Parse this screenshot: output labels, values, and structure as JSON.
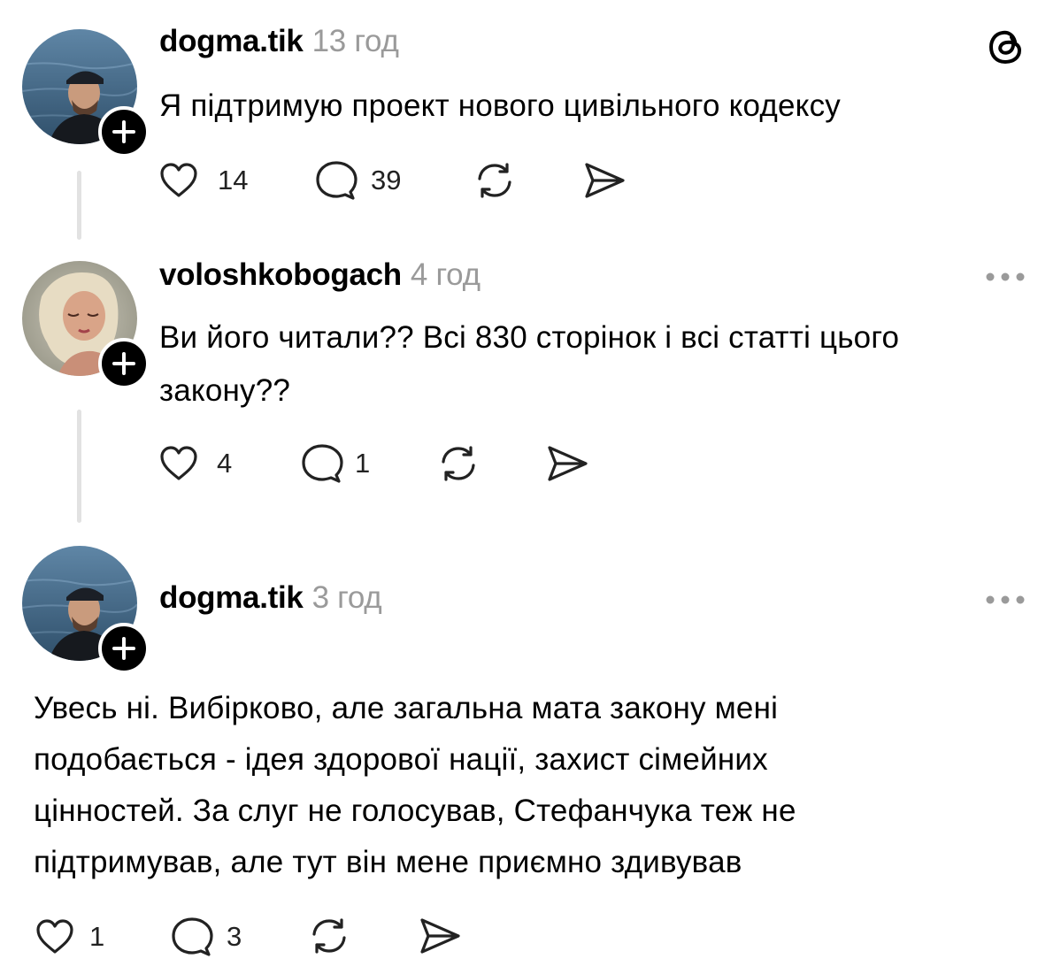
{
  "posts": [
    {
      "username": "dogma.tik",
      "time": "13 год",
      "text": "Я підтримую проект нового цивільного кодексу",
      "likes": "14",
      "replies": "39"
    },
    {
      "username": "voloshkobogach",
      "time": "4 год",
      "text_line1": "Ви його читали?? Всі 830 сторінок і всі статті цього",
      "text_line2": "закону??",
      "likes": "4",
      "replies": "1"
    },
    {
      "username": "dogma.tik",
      "time": "3 год",
      "text_lines": [
        "Увесь ні. Вибірково, але загальна мата закону мені",
        "подобається - ідея здорової нації, захист сімейних",
        "цінностей. За слуг не голосував, Стефанчука теж не",
        "підтримував, але тут він мене приємно здивував"
      ],
      "likes": "1",
      "replies": "3"
    }
  ],
  "icons": {
    "app_logo": "threads-logo-icon",
    "like": "heart-icon",
    "reply": "comment-bubble-icon",
    "repost": "repost-icon",
    "share": "send-icon",
    "more": "ellipsis-icon",
    "follow": "plus-icon"
  },
  "colors": {
    "text": "#000000",
    "muted": "#9a9a9a",
    "thread_line": "#e2e2e2",
    "icon": "#222222"
  }
}
